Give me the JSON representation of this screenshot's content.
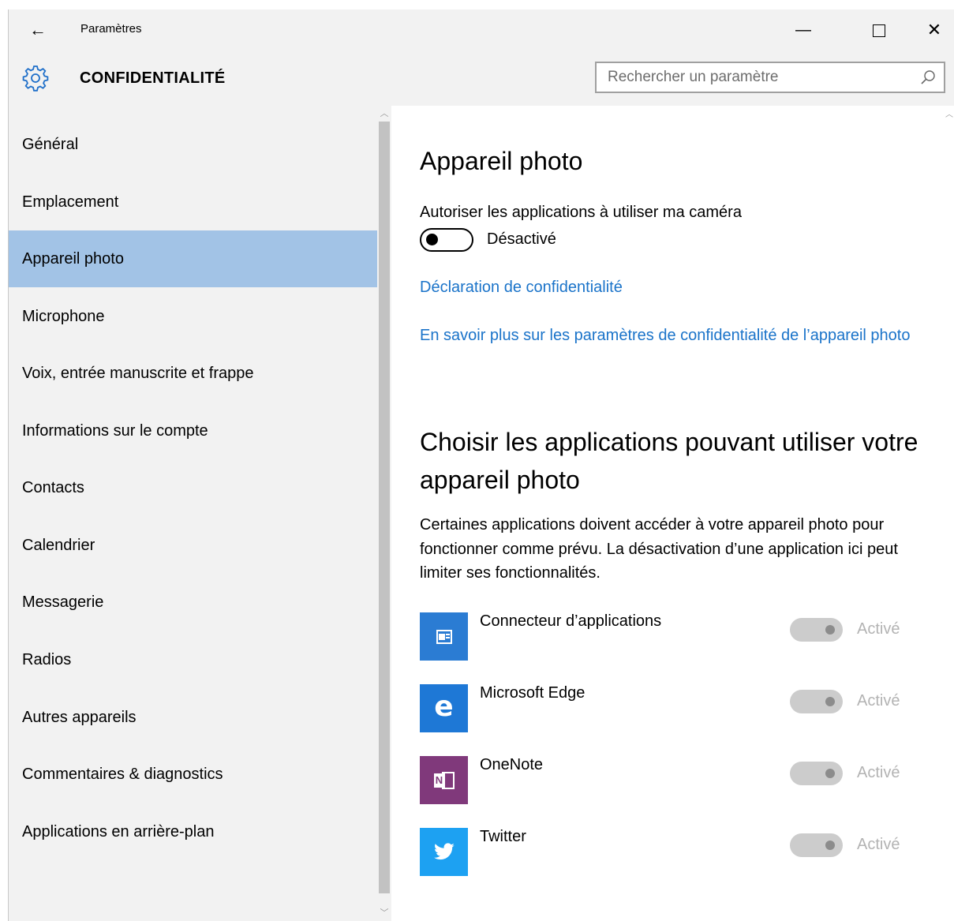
{
  "window": {
    "title": "Paramètres",
    "back_glyph": "←",
    "minimize_glyph": "—",
    "close_glyph": "✕"
  },
  "header": {
    "section_title": "CONFIDENTIALITÉ",
    "section_icon": "gear-icon",
    "search_placeholder": "Rechercher un paramètre",
    "search_icon": "search-icon"
  },
  "sidebar": {
    "selected_index": 2,
    "items": [
      {
        "label": "Général"
      },
      {
        "label": "Emplacement"
      },
      {
        "label": "Appareil photo"
      },
      {
        "label": "Microphone"
      },
      {
        "label": "Voix, entrée manuscrite et frappe"
      },
      {
        "label": "Informations sur le compte"
      },
      {
        "label": "Contacts"
      },
      {
        "label": "Calendrier"
      },
      {
        "label": "Messagerie"
      },
      {
        "label": "Radios"
      },
      {
        "label": "Autres appareils"
      },
      {
        "label": "Commentaires & diagnostics"
      },
      {
        "label": "Applications en arrière-plan"
      }
    ]
  },
  "main": {
    "title": "Appareil photo",
    "allow_label": "Autoriser les applications à utiliser ma caméra",
    "allow_toggle": {
      "on": false,
      "state_label": "Désactivé"
    },
    "privacy_link": "Déclaration de confidentialité",
    "learn_more_link": "En savoir plus sur les paramètres de confidentialité de l’appareil photo",
    "choose_title": "Choisir les applications pouvant utiliser votre appareil photo",
    "choose_desc": "Certaines applications doivent accéder à votre appareil photo pour fonctionner comme prévu. La désactivation d’une application ici peut limiter ses fonctionnalités.",
    "apps": [
      {
        "name": "Connecteur d’applications",
        "state": "Activé",
        "on": true,
        "enabled": false,
        "icon": "app-connector-icon",
        "icon_color": "#2b7cd3"
      },
      {
        "name": "Microsoft Edge",
        "state": "Activé",
        "on": true,
        "enabled": false,
        "icon": "edge-icon",
        "icon_color": "#1e78d6",
        "icon_glyph": "e"
      },
      {
        "name": "OneNote",
        "state": "Activé",
        "on": true,
        "enabled": false,
        "icon": "onenote-icon",
        "icon_color": "#80397b",
        "icon_glyph": "N"
      },
      {
        "name": "Twitter",
        "state": "Activé",
        "on": true,
        "enabled": false,
        "icon": "twitter-icon",
        "icon_color": "#1da1f2"
      }
    ]
  },
  "colors": {
    "accent_link": "#1a73c9",
    "selected_bg": "#a2c3e6",
    "chrome_bg": "#f2f2f2"
  }
}
